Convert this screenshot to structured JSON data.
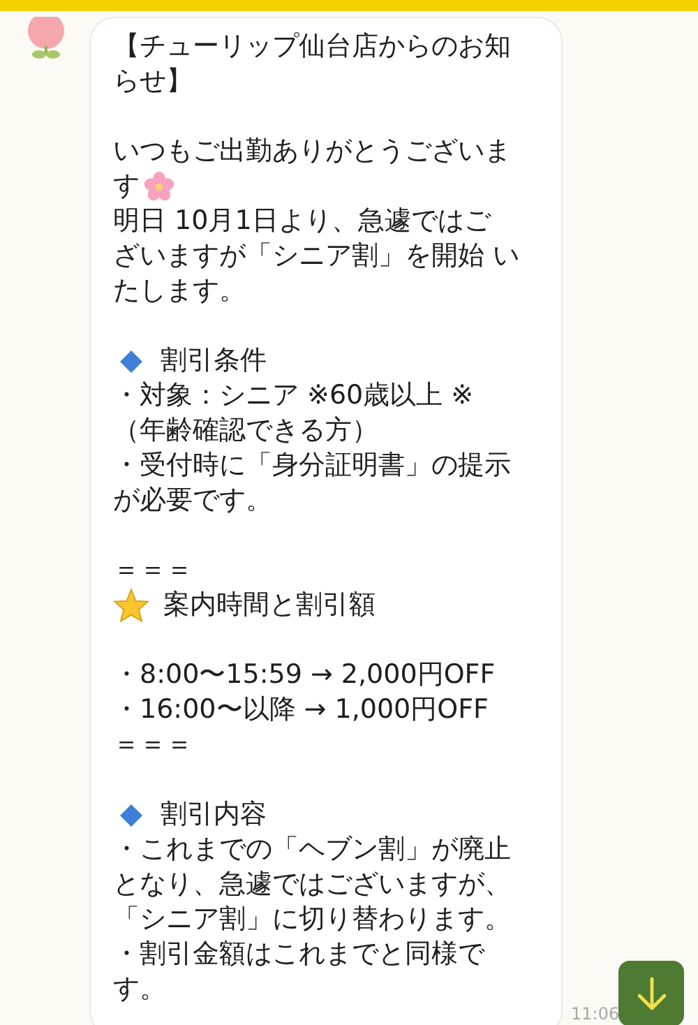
{
  "message": {
    "lines": [
      {
        "kind": "text",
        "text": "【チューリップ仙台店からのお知"
      },
      {
        "kind": "text",
        "text": "らせ】"
      },
      {
        "kind": "blank"
      },
      {
        "kind": "text",
        "text": "いつもご出勤ありがとうございま"
      },
      {
        "kind": "flower-after",
        "text": "す"
      },
      {
        "kind": "text",
        "text": "明日 10月1日より、急遽ではご"
      },
      {
        "kind": "text",
        "text": "ざいますが「シニア割」を開始 い"
      },
      {
        "kind": "text",
        "text": "たします。"
      },
      {
        "kind": "blank"
      },
      {
        "kind": "diamond-before",
        "text": "割引条件"
      },
      {
        "kind": "text",
        "text": "・対象：シニア ※60歳以上 ※"
      },
      {
        "kind": "text",
        "text": "（年齢確認できる方）"
      },
      {
        "kind": "text",
        "text": "・受付時に「身分証明書」の提示"
      },
      {
        "kind": "text",
        "text": "が必要です。"
      },
      {
        "kind": "blank"
      },
      {
        "kind": "text",
        "text": "＝＝＝"
      },
      {
        "kind": "star-before",
        "text": "案内時間と割引額"
      },
      {
        "kind": "blank"
      },
      {
        "kind": "text",
        "text": "・8:00〜15:59 → 2,000円OFF"
      },
      {
        "kind": "text",
        "text": "・16:00〜以降 → 1,000円OFF"
      },
      {
        "kind": "text",
        "text": "＝＝＝"
      },
      {
        "kind": "blank"
      },
      {
        "kind": "diamond-before",
        "text": "割引内容"
      },
      {
        "kind": "text",
        "text": "・これまでの「ヘブン割」が廃止"
      },
      {
        "kind": "text",
        "text": "となり、急遽ではございますが、"
      },
      {
        "kind": "text",
        "text": "「シニア割」に切り替わります。"
      },
      {
        "kind": "text",
        "text": "・割引金額はこれまでと同様で"
      },
      {
        "kind": "text",
        "text": "す。"
      }
    ],
    "time": "11:06"
  }
}
